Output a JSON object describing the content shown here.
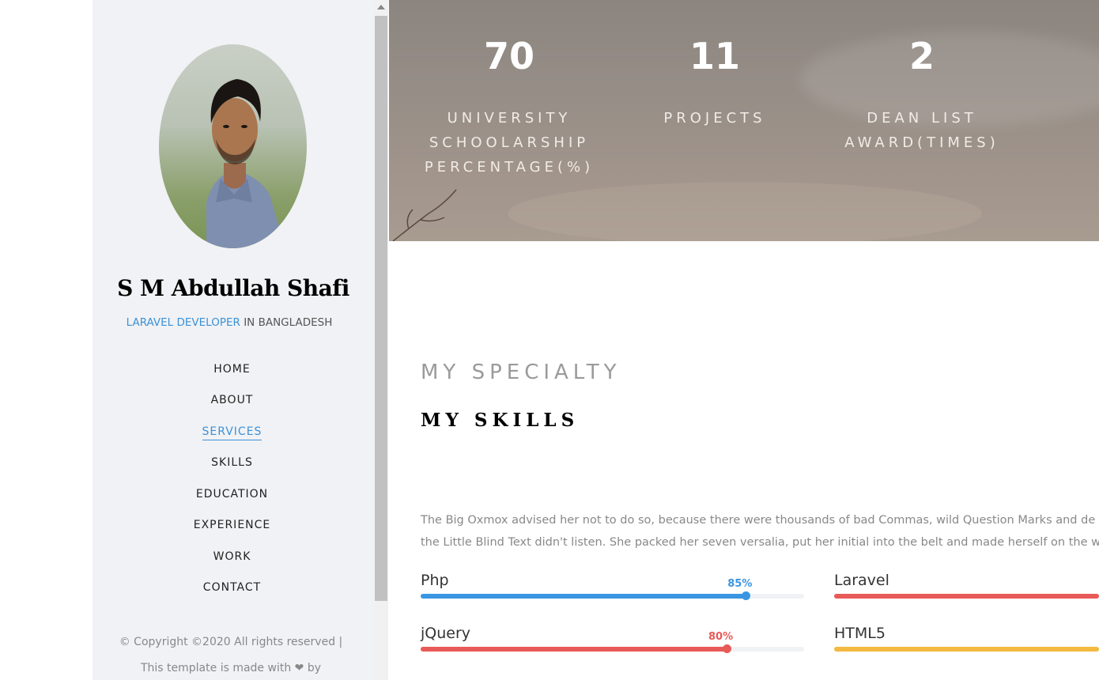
{
  "profile": {
    "name": "S M Abdullah Shafi",
    "role": "LARAVEL DEVELOPER",
    "location": "IN BANGLADESH"
  },
  "nav": [
    {
      "label": "HOME",
      "active": false
    },
    {
      "label": "ABOUT",
      "active": false
    },
    {
      "label": "SERVICES",
      "active": true
    },
    {
      "label": "SKILLS",
      "active": false
    },
    {
      "label": "EDUCATION",
      "active": false
    },
    {
      "label": "EXPERIENCE",
      "active": false
    },
    {
      "label": "WORK",
      "active": false
    },
    {
      "label": "CONTACT",
      "active": false
    }
  ],
  "footer": {
    "line1": "© Copyright ©2020 All rights reserved |",
    "line2": "This template is made with ❤ by"
  },
  "stats": [
    {
      "number": "70",
      "label_lines": [
        "UNIVERSITY",
        "SCHOOLARSHIP",
        "PERCENTAGE(%)"
      ]
    },
    {
      "number": "11",
      "label_lines": [
        "PROJECTS"
      ]
    },
    {
      "number": "2",
      "label_lines": [
        "DEAN LIST",
        "AWARD(TIMES)"
      ]
    }
  ],
  "section": {
    "subheading": "MY SPECIALTY",
    "heading": "MY SKILLS",
    "paragraph_lines": [
      "The Big Oxmox advised her not to do so, because there were thousands of bad Commas, wild Question Marks and de",
      "the Little Blind Text didn't listen. She packed her seven versalia, put her initial into the belt and made herself on the wa"
    ]
  },
  "skills": [
    {
      "name": "Php",
      "percent": 85,
      "percent_label": "85%",
      "color": "#3a96e3"
    },
    {
      "name": "Laravel",
      "percent": 100,
      "percent_label": "",
      "color": "#e85a57"
    },
    {
      "name": "jQuery",
      "percent": 80,
      "percent_label": "80%",
      "color": "#e85a57"
    },
    {
      "name": "HTML5",
      "percent": 100,
      "percent_label": "",
      "color": "#f3b940"
    }
  ],
  "colors": {
    "accent": "#3a91d8",
    "sidebar_bg": "#f1f2f5"
  }
}
